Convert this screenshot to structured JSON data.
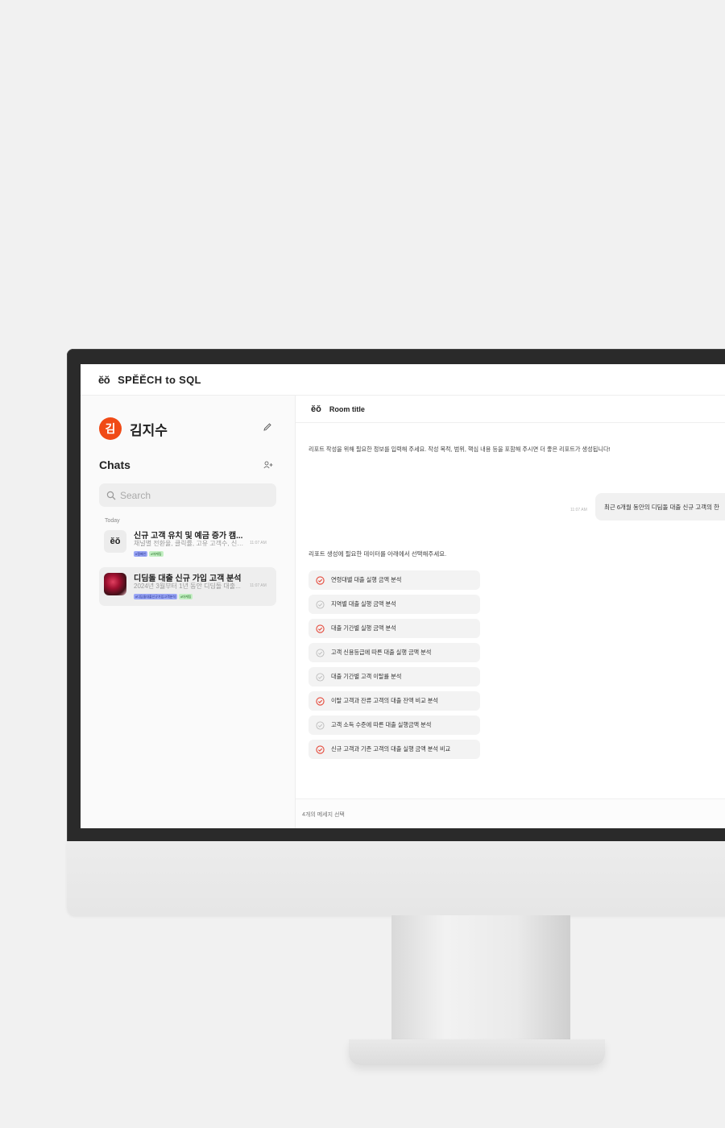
{
  "app": {
    "logo": "ĕŏ",
    "name": "SPĔĔCH to SQL"
  },
  "sidebar": {
    "user": {
      "avatar_initial": "김",
      "name": "김지수",
      "edit_icon": "pencil-icon"
    },
    "chats_title": "Chats",
    "add_icon": "add-user-icon",
    "search": {
      "placeholder": "Search",
      "value": ""
    },
    "section_label": "Today",
    "chats": [
      {
        "thumb": "ĕŏ",
        "title": "신규 고객 유치 및 예금 증가 캠...",
        "preview": "채널별 전환율, 클릭률, 고유 고객수, 신규...",
        "time": "11:07 AM",
        "tags": [
          "#캠페인",
          "#마케팅"
        ],
        "active": false
      },
      {
        "thumb": "photo",
        "title": "디딤돌 대출 신규 가입 고객 분석",
        "preview": "2024년 3월부터 1년 동안 디딤돌 대출...",
        "time": "11:07 AM",
        "tags": [
          "#디딤돌대출신규가입고객분석",
          "#마케팅"
        ],
        "active": true
      }
    ]
  },
  "room": {
    "logo": "ĕŏ",
    "title": "Room title",
    "intro": "리포트 작성을 위해 필요한 정보를 입력해 주세요. 작성 목적, 범위, 핵심 내용 등을 포함해 주시면 더 좋은 리포트가 생성됩니다!",
    "user_message": {
      "time": "11:07 AM",
      "text": "최근 6개월 동안의 디딤돌 대출 신규 고객의 한"
    },
    "select_prompt": "리포트 생성에 필요한 데이터를 아래에서 선택해주세요.",
    "options": [
      {
        "label": "연령대별 대출 실행 금액 분석",
        "checked": true
      },
      {
        "label": "지역별 대출 실행 금액 분석",
        "checked": false
      },
      {
        "label": "대출 기간별 실행 금액 분석",
        "checked": true
      },
      {
        "label": "고객 신용등급에 따른 대출 실행 금액 분석",
        "checked": false
      },
      {
        "label": "대출 기간별 고객 이탈률 분석",
        "checked": false
      },
      {
        "label": "이탈 고객과 잔류 고객의 대출 잔액 비교 분석",
        "checked": true
      },
      {
        "label": "고객 소득 수준에 따른 대출 실행금액 분석",
        "checked": false
      },
      {
        "label": "신규 고객과 기존 고객의 대출 실행 금액 분석 비교",
        "checked": true
      }
    ],
    "footer_text": "4개의 메세지 선택"
  },
  "colors": {
    "accent": "#f04a16",
    "checked": "#e5483a",
    "unchecked": "#bdbdbd"
  }
}
